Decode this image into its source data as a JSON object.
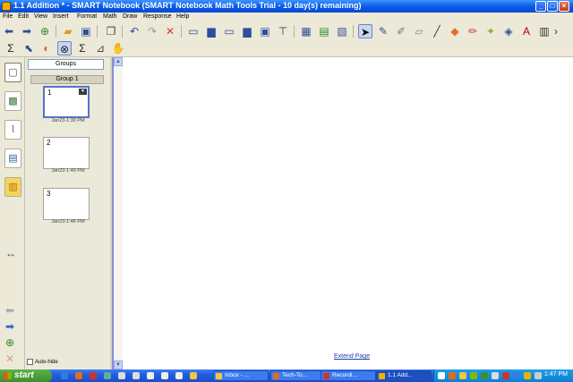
{
  "window": {
    "title": "1.1 Addition * - SMART Notebook (SMART Notebook Math Tools Trial - 10 day(s) remaining)"
  },
  "menu": [
    "File",
    "Edit",
    "View",
    "Insert",
    "Format",
    "Math",
    "Draw",
    "Response",
    "Help"
  ],
  "sorter": {
    "groups_label": "Groups",
    "group_name": "Group 1",
    "pages": [
      {
        "num": "1",
        "date": "Jan23-1:30 PM"
      },
      {
        "num": "2",
        "date": "Jan23-1:40 PM"
      },
      {
        "num": "3",
        "date": "Jan23-1:46 PM"
      }
    ],
    "autohide_label": "Auto-hide"
  },
  "canvas": {
    "extend_label": "Extend Page"
  },
  "taskbar": {
    "start_label": "start",
    "tasks": [
      "Inbox - ...",
      "Tech-To...",
      "Recordi...",
      "1.1 Add..."
    ],
    "clock": "1:47 PM"
  }
}
